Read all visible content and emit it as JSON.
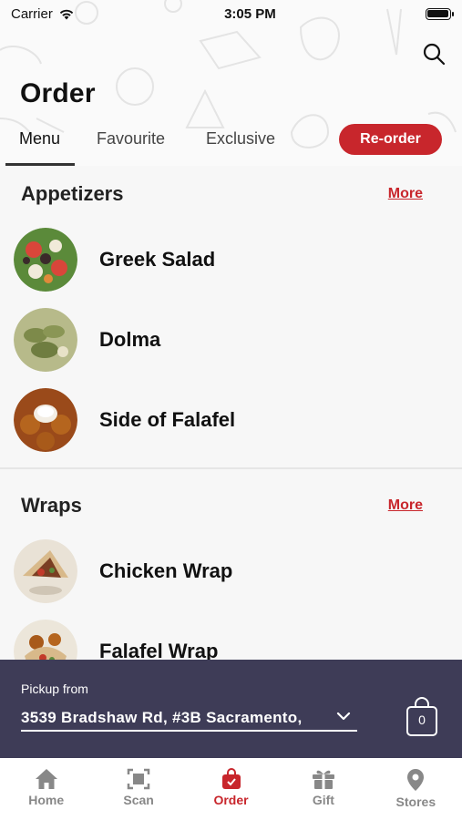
{
  "status_bar": {
    "carrier": "Carrier",
    "time": "3:05 PM",
    "battery_level": 1.0
  },
  "header": {
    "title": "Order"
  },
  "tabs": [
    {
      "label": "Menu",
      "active": true
    },
    {
      "label": "Favourite",
      "active": false
    },
    {
      "label": "Exclusive",
      "active": false
    }
  ],
  "reorder_label": "Re-order",
  "sections": [
    {
      "title": "Appetizers",
      "more_label": "More",
      "items": [
        {
          "name": "Greek Salad"
        },
        {
          "name": "Dolma"
        },
        {
          "name": "Side of Falafel"
        }
      ]
    },
    {
      "title": "Wraps",
      "more_label": "More",
      "items": [
        {
          "name": "Chicken Wrap"
        },
        {
          "name": "Falafel Wrap"
        }
      ]
    }
  ],
  "pickup": {
    "label": "Pickup from",
    "address": "3539 Bradshaw Rd, #3B Sacramento,",
    "cart_count": "0"
  },
  "tab_bar": [
    {
      "label": "Home",
      "icon": "home-icon",
      "active": false
    },
    {
      "label": "Scan",
      "icon": "scan-icon",
      "active": false
    },
    {
      "label": "Order",
      "icon": "shopping-bag-icon",
      "active": true
    },
    {
      "label": "Gift",
      "icon": "gift-icon",
      "active": false
    },
    {
      "label": "Stores",
      "icon": "location-pin-icon",
      "active": false
    }
  ],
  "colors": {
    "accent": "#c8262c",
    "pickup_bar": "#3e3c57",
    "inactive_tab": "#888888"
  }
}
